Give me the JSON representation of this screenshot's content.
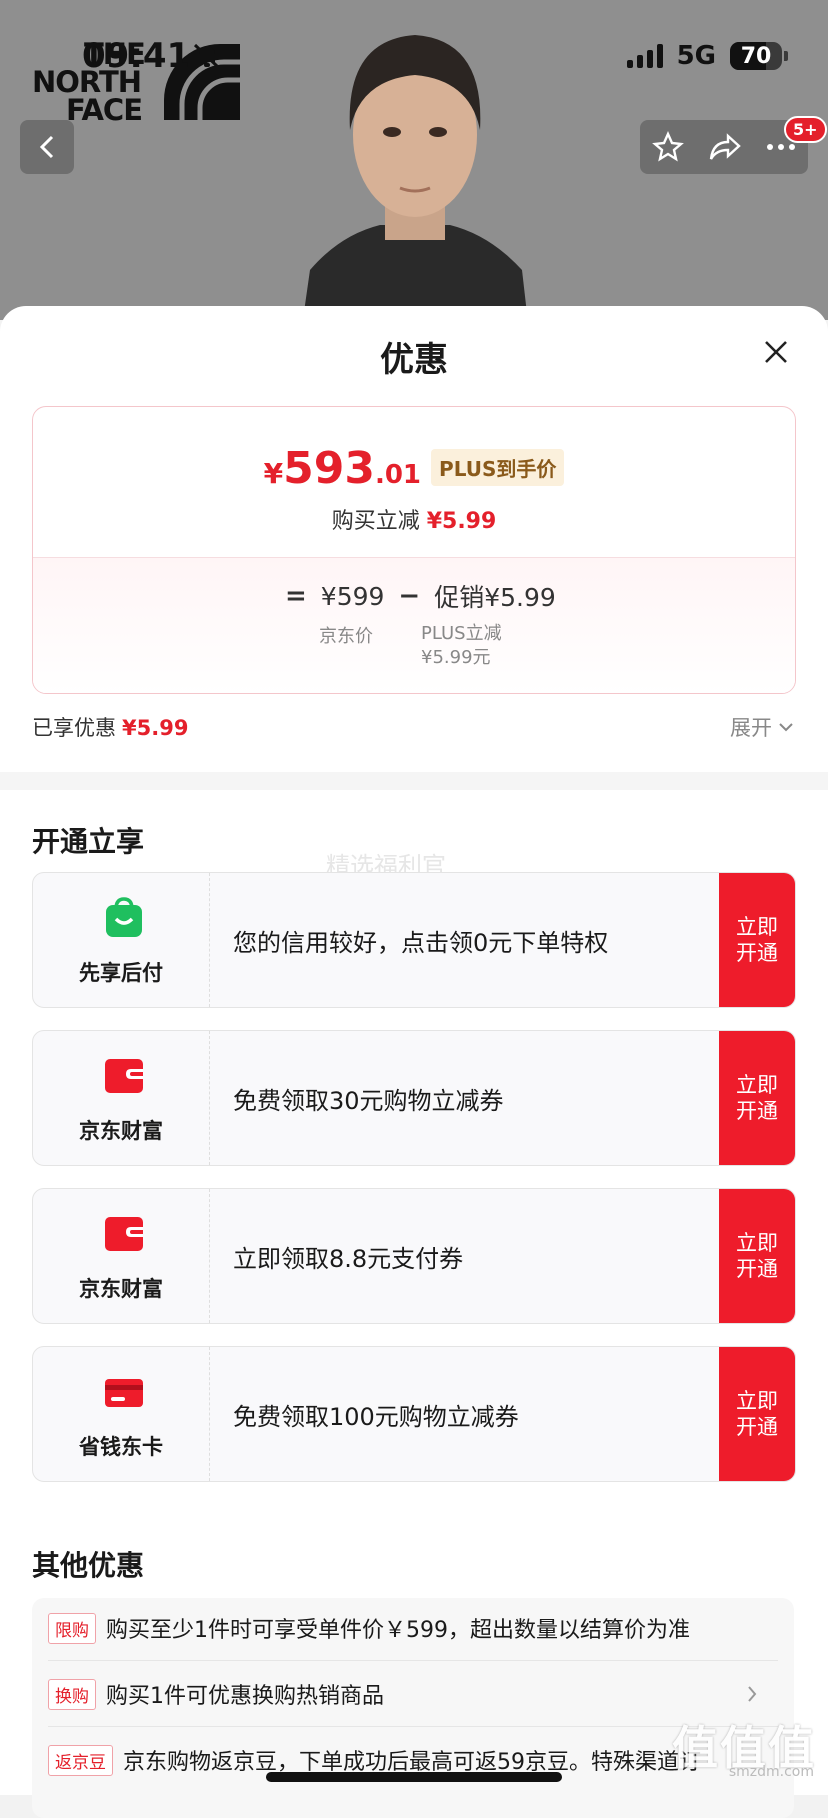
{
  "status_bar": {
    "time": "09:41",
    "network": "5G",
    "battery": "70",
    "battery_level": 0.7
  },
  "brand": {
    "line1": "THE",
    "line2": "NORTH",
    "line3": "FACE"
  },
  "header_toolbar": {
    "badge": "5+",
    "icons": [
      "back-icon",
      "star-icon",
      "share-icon",
      "more-icon"
    ]
  },
  "sheet": {
    "title": "优惠"
  },
  "price_card": {
    "currency": "¥",
    "price_int": "593",
    "price_dec": ".01",
    "plus_tag": "PLUS到手价",
    "reduce_label": "购买立减",
    "reduce_value": "¥5.99",
    "equals": "=",
    "jd_price": "¥599",
    "minus": "−",
    "promo": "促销¥5.99",
    "jd_price_label": "京东价",
    "plus_sub1": "PLUS立减",
    "plus_sub2": "¥5.99元"
  },
  "enjoyed": {
    "label": "已享优惠",
    "value": "¥5.99",
    "expand": "展开"
  },
  "open_section": {
    "title": "开通立享",
    "watermark": "精选福利官",
    "offers": [
      {
        "name": "先享后付",
        "desc": "您的信用较好，点击领0元下单特权",
        "button": "立即\n开通",
        "icon": "green-bag-icon"
      },
      {
        "name": "京东财富",
        "desc": "免费领取30元购物立减券",
        "button": "立即\n开通",
        "icon": "red-wallet-icon"
      },
      {
        "name": "京东财富",
        "desc": "立即领取8.8元支付券",
        "button": "立即\n开通",
        "icon": "red-wallet-icon"
      },
      {
        "name": "省钱东卡",
        "desc": "免费领取100元购物立减券",
        "button": "立即\n开通",
        "icon": "red-card-icon"
      }
    ]
  },
  "other_section": {
    "title": "其他优惠",
    "items": [
      {
        "tag": "限购",
        "text": "购买至少1件时可享受单件价￥599，超出数量以结算价为准"
      },
      {
        "tag": "换购",
        "text": "购买1件可优惠换购热销商品"
      },
      {
        "tag": "返京豆",
        "text": "京东购物返京豆，下单成功后最高可返59京豆。特殊渠道订"
      }
    ]
  },
  "corner_watermark": {
    "main": "值值值",
    "sub": "smzdm.com"
  }
}
